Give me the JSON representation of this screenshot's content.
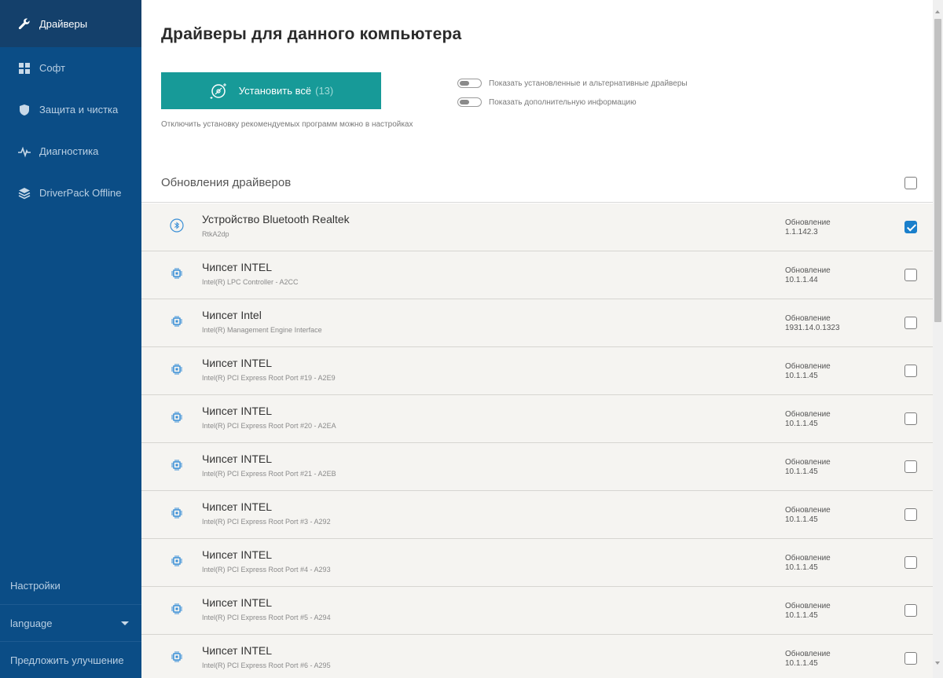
{
  "sidebar": {
    "items": [
      {
        "label": "Драйверы",
        "icon": "wrench-icon",
        "active": true
      },
      {
        "label": "Софт",
        "icon": "grid-icon",
        "active": false
      },
      {
        "label": "Защита и чистка",
        "icon": "shield-icon",
        "active": false
      },
      {
        "label": "Диагностика",
        "icon": "pulse-icon",
        "active": false
      },
      {
        "label": "DriverPack Offline",
        "icon": "layers-icon",
        "active": false
      }
    ],
    "bottom": {
      "settings": "Настройки",
      "language": "language",
      "suggest": "Предложить улучшение"
    }
  },
  "main": {
    "title": "Драйверы для данного компьютера",
    "install_button": {
      "label": "Установить всё",
      "count": "(13)"
    },
    "install_note": "Отключить установку рекомендуемых программ можно в настройках",
    "toggles": [
      {
        "label": "Показать установленные и альтернативные драйверы",
        "on": false
      },
      {
        "label": "Показать дополнительную информацию",
        "on": false
      }
    ],
    "section": {
      "title": "Обновления драйверов",
      "checked": false
    },
    "rows": [
      {
        "name": "Устройство Bluetooth Realtek",
        "sub": "RtkA2dp",
        "status": "Обновление",
        "version": "1.1.142.3",
        "checked": true,
        "icon": "bluetooth-icon"
      },
      {
        "name": "Чипсет INTEL",
        "sub": "Intel(R) LPC Controller - A2CC",
        "status": "Обновление",
        "version": "10.1.1.44",
        "checked": false,
        "icon": "chip-icon"
      },
      {
        "name": "Чипсет Intel",
        "sub": "Intel(R) Management Engine Interface",
        "status": "Обновление",
        "version": "1931.14.0.1323",
        "checked": false,
        "icon": "chip-icon"
      },
      {
        "name": "Чипсет INTEL",
        "sub": "Intel(R) PCI Express Root Port #19 - A2E9",
        "status": "Обновление",
        "version": "10.1.1.45",
        "checked": false,
        "icon": "chip-icon"
      },
      {
        "name": "Чипсет INTEL",
        "sub": "Intel(R) PCI Express Root Port #20 - A2EA",
        "status": "Обновление",
        "version": "10.1.1.45",
        "checked": false,
        "icon": "chip-icon"
      },
      {
        "name": "Чипсет INTEL",
        "sub": "Intel(R) PCI Express Root Port #21 - A2EB",
        "status": "Обновление",
        "version": "10.1.1.45",
        "checked": false,
        "icon": "chip-icon"
      },
      {
        "name": "Чипсет INTEL",
        "sub": "Intel(R) PCI Express Root Port #3 - A292",
        "status": "Обновление",
        "version": "10.1.1.45",
        "checked": false,
        "icon": "chip-icon"
      },
      {
        "name": "Чипсет INTEL",
        "sub": "Intel(R) PCI Express Root Port #4 - A293",
        "status": "Обновление",
        "version": "10.1.1.45",
        "checked": false,
        "icon": "chip-icon"
      },
      {
        "name": "Чипсет INTEL",
        "sub": "Intel(R) PCI Express Root Port #5 - A294",
        "status": "Обновление",
        "version": "10.1.1.45",
        "checked": false,
        "icon": "chip-icon"
      },
      {
        "name": "Чипсет INTEL",
        "sub": "Intel(R) PCI Express Root Port #6 - A295",
        "status": "Обновление",
        "version": "10.1.1.45",
        "checked": false,
        "icon": "chip-icon"
      }
    ]
  },
  "colors": {
    "sidebar_bg": "#0b4d86",
    "sidebar_active": "#14406b",
    "accent": "#179a98",
    "checkbox_checked": "#1a7fcb",
    "row_bg": "#f5f4f1"
  }
}
